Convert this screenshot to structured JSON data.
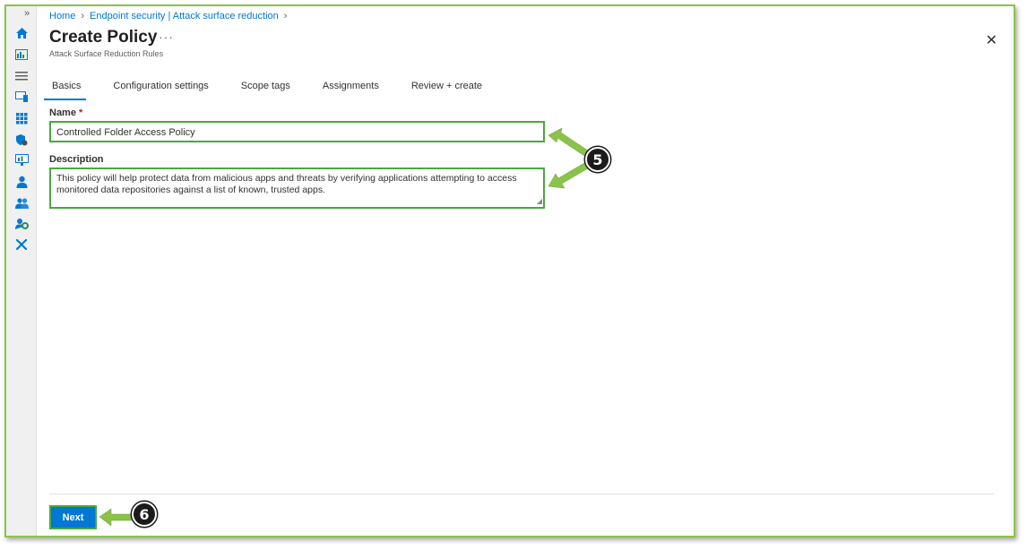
{
  "breadcrumb": {
    "home": "Home",
    "section": "Endpoint security | Attack surface reduction"
  },
  "header": {
    "title": "Create Policy",
    "more": "···",
    "subtitle": "Attack Surface Reduction Rules",
    "close": "✕"
  },
  "tabs": [
    {
      "label": "Basics",
      "active": true
    },
    {
      "label": "Configuration settings"
    },
    {
      "label": "Scope tags"
    },
    {
      "label": "Assignments"
    },
    {
      "label": "Review + create"
    }
  ],
  "form": {
    "name_label": "Name",
    "required_mark": "*",
    "name_value": "Controlled Folder Access Policy",
    "description_label": "Description",
    "description_value": "This policy will help protect data from malicious apps and threats by verifying applications attempting to access monitored data repositories against a list of known, trusted apps."
  },
  "footer": {
    "next_label": "Next"
  },
  "annotations": {
    "step5": "5",
    "step6": "6"
  },
  "rail": {
    "expand": "»",
    "icons": [
      "home-icon",
      "dashboard-icon",
      "all-services-icon",
      "devices-icon",
      "apps-icon",
      "endpoint-security-icon",
      "reports-icon",
      "users-icon",
      "groups-icon",
      "tenant-admin-icon",
      "troubleshooting-icon"
    ]
  },
  "colors": {
    "accent": "#0078d4",
    "highlight": "#4aa83f",
    "arrow": "#8bc34a"
  }
}
